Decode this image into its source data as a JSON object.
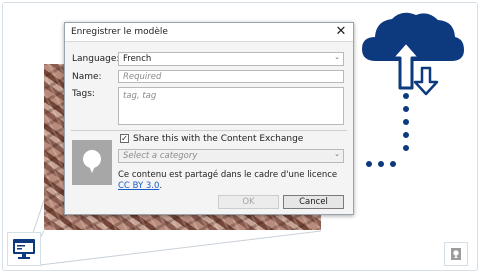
{
  "dialog": {
    "title": "Enregistrer le modèle",
    "language_label": "Language:",
    "language_value": "French",
    "name_label": "Name:",
    "name_placeholder": "Required",
    "tags_label": "Tags:",
    "tags_placeholder": "tag, tag",
    "share_label": "Share this with the Content Exchange",
    "share_checked": true,
    "category_placeholder": "Select a category",
    "license_text": "Ce contenu est partagé dans le cadre d'une licence ",
    "license_link": "CC BY 3.0",
    "license_end": ".",
    "ok_label": "OK",
    "cancel_label": "Cancel"
  },
  "colors": {
    "accent_blue": "#0d3a7e",
    "link": "#1a5bc4"
  },
  "icons": [
    "close-icon",
    "chevron-down-icon",
    "checkmark-icon",
    "image-placeholder-icon",
    "cloud-upload-download-icon",
    "monitor-icon",
    "image-icon"
  ]
}
